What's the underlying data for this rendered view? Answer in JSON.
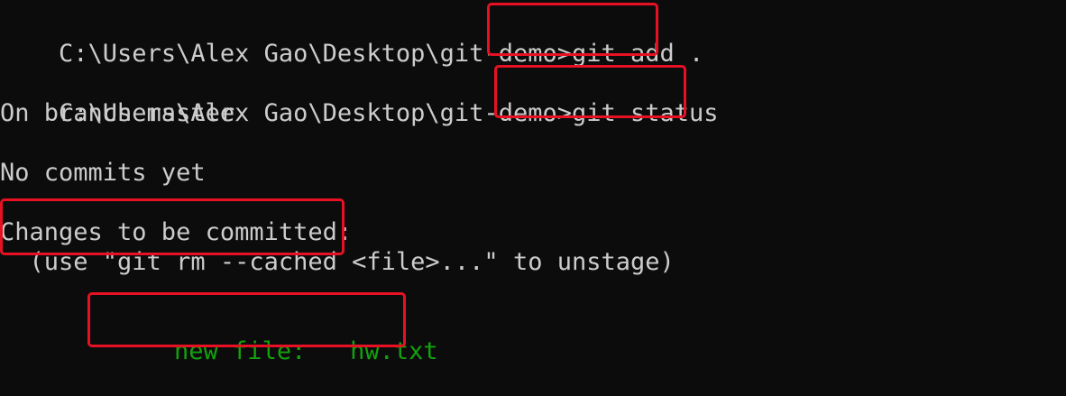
{
  "terminal": {
    "prompt_1": "C:\\Users\\Alex Gao\\Desktop\\git-demo>",
    "command_1": "git add .",
    "prompt_2": "C:\\Users\\Alex Gao\\Desktop\\git-demo>",
    "command_2": "git status",
    "output": {
      "branch_line": "On branch master",
      "no_commits_line": "No commits yet",
      "changes_header": "Changes to be committed:",
      "unstage_hint": "  (use \"git rm --cached <file>...\" to unstage)",
      "new_file_label": "new file:",
      "new_file_name": "hw.txt"
    }
  },
  "colors": {
    "background": "#0c0c0c",
    "text": "#cccccc",
    "staged_green": "#13a10e",
    "highlight_red": "#e81123"
  }
}
